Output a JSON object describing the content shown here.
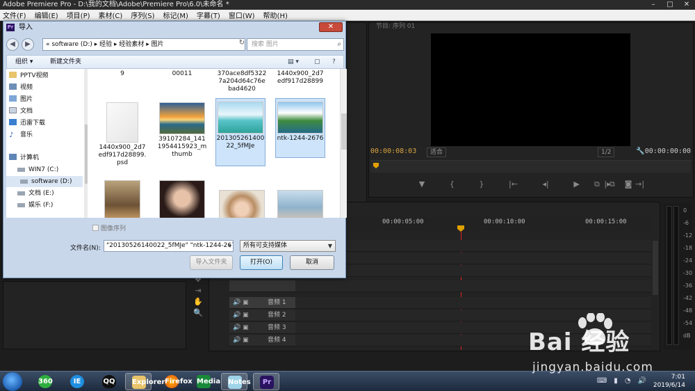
{
  "window": {
    "title": "Adobe Premiere Pro - D:\\我的文档\\Adobe\\Premiere Pro\\6.0\\未命名 *",
    "controls": [
      "–",
      "□",
      "✕"
    ]
  },
  "menu": [
    "文件(F)",
    "编辑(E)",
    "项目(P)",
    "素材(C)",
    "序列(S)",
    "标记(M)",
    "字幕(T)",
    "窗口(W)",
    "帮助(H)"
  ],
  "monitor": {
    "header": "节目: 序列 01",
    "timecode_left": "00:00:08:03",
    "fit": "适合",
    "fraction": "1/2",
    "timecode_right": "00:00:00:00",
    "transport": [
      "▼",
      "{",
      "}",
      "|←",
      "◂|",
      "▶",
      "|▸",
      "→|",
      "⧉",
      "⧉",
      "◙"
    ]
  },
  "timeline": {
    "ruler": [
      "00:00:05:00",
      "00:00:10:00",
      "00:00:15:00"
    ],
    "playhead_seconds": 11,
    "tracks": [
      {
        "icon": "🔊 ▣",
        "label": "音频 1",
        "selected": true
      },
      {
        "icon": "🔊 ▣",
        "label": "音频 2",
        "selected": false
      },
      {
        "icon": "🔊 ▣",
        "label": "音频 3",
        "selected": false
      },
      {
        "icon": "🔊 ▣",
        "label": "音频 4",
        "selected": false
      }
    ]
  },
  "meters": {
    "scale": [
      "0",
      "-6",
      "-12",
      "-18",
      "-24",
      "-30",
      "-36",
      "-42",
      "-48",
      "-54",
      "dB"
    ]
  },
  "dialog": {
    "title": "导入",
    "close": "✕",
    "address": "«  software (D:)  ▸  经验  ▸  经验素材  ▸  图片",
    "address_dropdown": "▾",
    "refresh": "↻",
    "search_placeholder": "搜索 图片",
    "organize": "组织 ▾",
    "new_folder": "新建文件夹",
    "view_icons": [
      "▤ ▾",
      "▢",
      "?"
    ],
    "nav": [
      {
        "label": "PPTV视频",
        "icon": "folder",
        "selected": false
      },
      {
        "label": "视频",
        "icon": "folder",
        "selected": false
      },
      {
        "label": "图片",
        "icon": "folder",
        "selected": false
      },
      {
        "label": "文档",
        "icon": "folder",
        "selected": false
      },
      {
        "label": "迅雷下载",
        "icon": "folder",
        "selected": false
      },
      {
        "label": "音乐",
        "icon": "music",
        "selected": false
      },
      {
        "label": "计算机",
        "icon": "computer",
        "selected": false
      },
      {
        "label": "WIN7 (C:)",
        "icon": "drive",
        "selected": false
      },
      {
        "label": "software (D:)",
        "icon": "drive",
        "selected": true
      },
      {
        "label": "文档 (E:)",
        "icon": "drive",
        "selected": false
      },
      {
        "label": "娱乐 (F:)",
        "icon": "drive",
        "selected": false
      }
    ],
    "files_top": [
      "9",
      "00011",
      "370ace8df53227a204d64c76ebad4620",
      "1440x900_2d7edf917d28899"
    ],
    "files": [
      {
        "name": "1440x900_2d7edf917d28899.psd",
        "selected": false
      },
      {
        "name": "39107284_1411954415923_mthumb",
        "selected": false
      },
      {
        "name": "20130526140022_5fMJe",
        "selected": true
      },
      {
        "name": "ntk-1244-2676",
        "selected": true
      }
    ],
    "sequence_label": "图像序列",
    "filename_label": "文件名(N):",
    "filename_value": "\"20130526140022_5fMJe\" \"ntk-1244-267",
    "filetype": "所有可支持媒体",
    "btn_import_folder": "导入文件夹",
    "btn_open": "打开(O)",
    "btn_cancel": "取消"
  },
  "taskbar": {
    "apps": [
      "360",
      "IE",
      "QQ",
      "Explorer",
      "Firefox",
      "Media",
      "Notes",
      "Pr"
    ],
    "clock_time": "7:01",
    "clock_date": "2019/6/14"
  },
  "watermark": {
    "brand": "Bai  经验",
    "url": "jingyan.baidu.com"
  },
  "colors": {
    "accent": "#e0a000",
    "playhead": "#d22222",
    "dialog_frame": "#c8d7ea",
    "selection": "#cde4fa"
  }
}
